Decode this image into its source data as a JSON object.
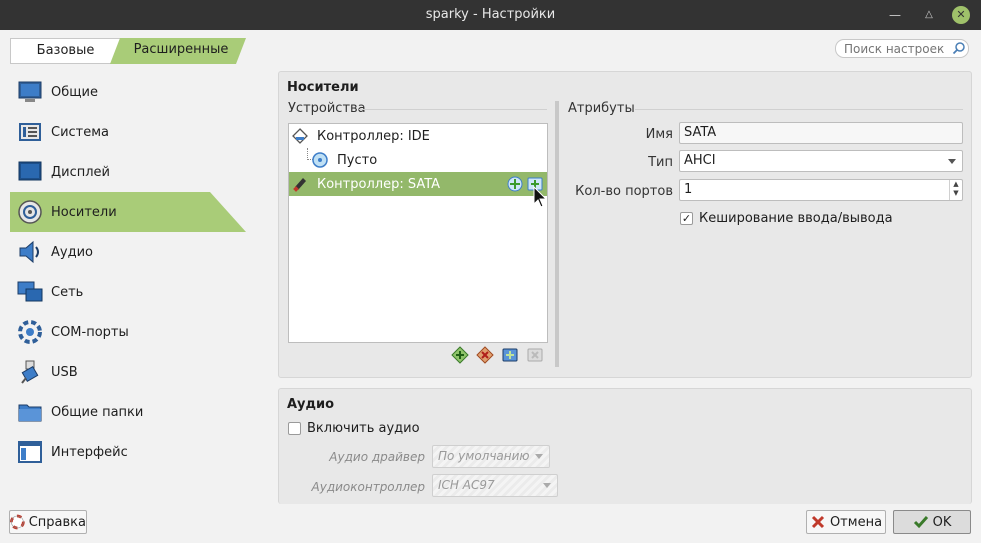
{
  "window": {
    "title": "sparky - Настройки"
  },
  "mode_tabs": {
    "basic": "Базовые",
    "advanced": "Расширенные"
  },
  "search": {
    "placeholder": "Поиск настроек"
  },
  "sidebar": {
    "items": [
      {
        "label": "Общие",
        "icon": "general-icon"
      },
      {
        "label": "Система",
        "icon": "system-icon"
      },
      {
        "label": "Дисплей",
        "icon": "display-icon"
      },
      {
        "label": "Носители",
        "icon": "storage-icon",
        "active": true
      },
      {
        "label": "Аудио",
        "icon": "audio-icon"
      },
      {
        "label": "Сеть",
        "icon": "network-icon"
      },
      {
        "label": "COM-порты",
        "icon": "serial-ports-icon"
      },
      {
        "label": "USB",
        "icon": "usb-icon"
      },
      {
        "label": "Общие папки",
        "icon": "shared-folders-icon"
      },
      {
        "label": "Интерфейс",
        "icon": "user-interface-icon"
      }
    ]
  },
  "storage": {
    "title": "Носители",
    "devices_label": "Устройства",
    "attributes_label": "Атрибуты",
    "tree": [
      {
        "label": "Контроллер: IDE",
        "icon": "ide-controller-icon"
      },
      {
        "label": "Пусто",
        "icon": "optical-disc-icon"
      },
      {
        "label": "Контроллер: SATA",
        "icon": "sata-controller-icon",
        "selected": true
      }
    ],
    "attributes": {
      "name_label": "Имя",
      "name_value": "SATA",
      "type_label": "Тип",
      "type_value": "AHCI",
      "ports_label": "Кол-во портов",
      "ports_value": "1",
      "cache_label": "Кеширование ввода/вывода",
      "cache_checked": true
    }
  },
  "audio": {
    "title": "Аудио",
    "enable_label": "Включить аудио",
    "enable_checked": false,
    "driver_label": "Аудио драйвер",
    "driver_value": "По умолчанию",
    "controller_label": "Аудиоконтроллер",
    "controller_value": "ICH AC97"
  },
  "buttons": {
    "help": "Справка",
    "cancel": "Отмена",
    "ok": "OK"
  },
  "colors": {
    "accent": "#a9cc78",
    "selected_row": "#93b86a",
    "titlebar": "#333333"
  }
}
